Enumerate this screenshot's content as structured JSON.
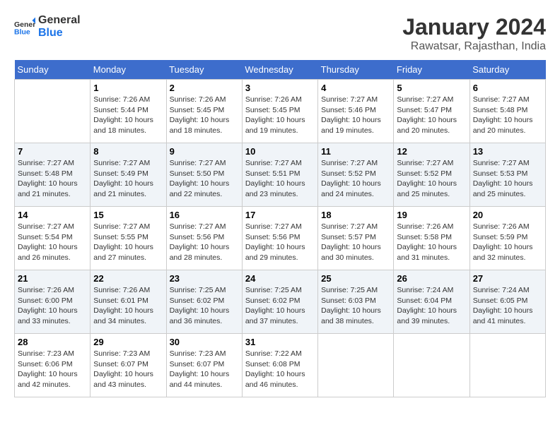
{
  "header": {
    "logo_line1": "General",
    "logo_line2": "Blue",
    "month": "January 2024",
    "location": "Rawatsar, Rajasthan, India"
  },
  "days_of_week": [
    "Sunday",
    "Monday",
    "Tuesday",
    "Wednesday",
    "Thursday",
    "Friday",
    "Saturday"
  ],
  "weeks": [
    [
      {
        "day": "",
        "info": ""
      },
      {
        "day": "1",
        "info": "Sunrise: 7:26 AM\nSunset: 5:44 PM\nDaylight: 10 hours\nand 18 minutes."
      },
      {
        "day": "2",
        "info": "Sunrise: 7:26 AM\nSunset: 5:45 PM\nDaylight: 10 hours\nand 18 minutes."
      },
      {
        "day": "3",
        "info": "Sunrise: 7:26 AM\nSunset: 5:45 PM\nDaylight: 10 hours\nand 19 minutes."
      },
      {
        "day": "4",
        "info": "Sunrise: 7:27 AM\nSunset: 5:46 PM\nDaylight: 10 hours\nand 19 minutes."
      },
      {
        "day": "5",
        "info": "Sunrise: 7:27 AM\nSunset: 5:47 PM\nDaylight: 10 hours\nand 20 minutes."
      },
      {
        "day": "6",
        "info": "Sunrise: 7:27 AM\nSunset: 5:48 PM\nDaylight: 10 hours\nand 20 minutes."
      }
    ],
    [
      {
        "day": "7",
        "info": "Sunrise: 7:27 AM\nSunset: 5:48 PM\nDaylight: 10 hours\nand 21 minutes."
      },
      {
        "day": "8",
        "info": "Sunrise: 7:27 AM\nSunset: 5:49 PM\nDaylight: 10 hours\nand 21 minutes."
      },
      {
        "day": "9",
        "info": "Sunrise: 7:27 AM\nSunset: 5:50 PM\nDaylight: 10 hours\nand 22 minutes."
      },
      {
        "day": "10",
        "info": "Sunrise: 7:27 AM\nSunset: 5:51 PM\nDaylight: 10 hours\nand 23 minutes."
      },
      {
        "day": "11",
        "info": "Sunrise: 7:27 AM\nSunset: 5:52 PM\nDaylight: 10 hours\nand 24 minutes."
      },
      {
        "day": "12",
        "info": "Sunrise: 7:27 AM\nSunset: 5:52 PM\nDaylight: 10 hours\nand 25 minutes."
      },
      {
        "day": "13",
        "info": "Sunrise: 7:27 AM\nSunset: 5:53 PM\nDaylight: 10 hours\nand 25 minutes."
      }
    ],
    [
      {
        "day": "14",
        "info": "Sunrise: 7:27 AM\nSunset: 5:54 PM\nDaylight: 10 hours\nand 26 minutes."
      },
      {
        "day": "15",
        "info": "Sunrise: 7:27 AM\nSunset: 5:55 PM\nDaylight: 10 hours\nand 27 minutes."
      },
      {
        "day": "16",
        "info": "Sunrise: 7:27 AM\nSunset: 5:56 PM\nDaylight: 10 hours\nand 28 minutes."
      },
      {
        "day": "17",
        "info": "Sunrise: 7:27 AM\nSunset: 5:56 PM\nDaylight: 10 hours\nand 29 minutes."
      },
      {
        "day": "18",
        "info": "Sunrise: 7:27 AM\nSunset: 5:57 PM\nDaylight: 10 hours\nand 30 minutes."
      },
      {
        "day": "19",
        "info": "Sunrise: 7:26 AM\nSunset: 5:58 PM\nDaylight: 10 hours\nand 31 minutes."
      },
      {
        "day": "20",
        "info": "Sunrise: 7:26 AM\nSunset: 5:59 PM\nDaylight: 10 hours\nand 32 minutes."
      }
    ],
    [
      {
        "day": "21",
        "info": "Sunrise: 7:26 AM\nSunset: 6:00 PM\nDaylight: 10 hours\nand 33 minutes."
      },
      {
        "day": "22",
        "info": "Sunrise: 7:26 AM\nSunset: 6:01 PM\nDaylight: 10 hours\nand 34 minutes."
      },
      {
        "day": "23",
        "info": "Sunrise: 7:25 AM\nSunset: 6:02 PM\nDaylight: 10 hours\nand 36 minutes."
      },
      {
        "day": "24",
        "info": "Sunrise: 7:25 AM\nSunset: 6:02 PM\nDaylight: 10 hours\nand 37 minutes."
      },
      {
        "day": "25",
        "info": "Sunrise: 7:25 AM\nSunset: 6:03 PM\nDaylight: 10 hours\nand 38 minutes."
      },
      {
        "day": "26",
        "info": "Sunrise: 7:24 AM\nSunset: 6:04 PM\nDaylight: 10 hours\nand 39 minutes."
      },
      {
        "day": "27",
        "info": "Sunrise: 7:24 AM\nSunset: 6:05 PM\nDaylight: 10 hours\nand 41 minutes."
      }
    ],
    [
      {
        "day": "28",
        "info": "Sunrise: 7:23 AM\nSunset: 6:06 PM\nDaylight: 10 hours\nand 42 minutes."
      },
      {
        "day": "29",
        "info": "Sunrise: 7:23 AM\nSunset: 6:07 PM\nDaylight: 10 hours\nand 43 minutes."
      },
      {
        "day": "30",
        "info": "Sunrise: 7:23 AM\nSunset: 6:07 PM\nDaylight: 10 hours\nand 44 minutes."
      },
      {
        "day": "31",
        "info": "Sunrise: 7:22 AM\nSunset: 6:08 PM\nDaylight: 10 hours\nand 46 minutes."
      },
      {
        "day": "",
        "info": ""
      },
      {
        "day": "",
        "info": ""
      },
      {
        "day": "",
        "info": ""
      }
    ]
  ]
}
